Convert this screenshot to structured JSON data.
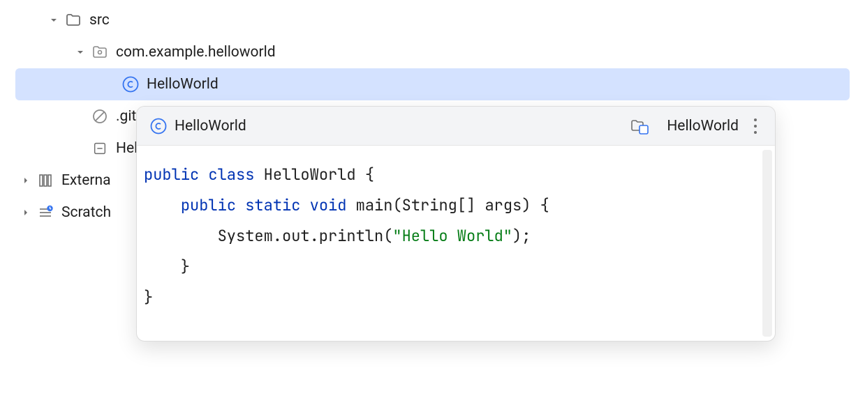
{
  "tree": {
    "src": {
      "label": "src"
    },
    "package": {
      "label": "com.example.helloworld"
    },
    "class_file": {
      "label": "HelloWorld"
    },
    "gitignore": {
      "label": ".gitig"
    },
    "hello_iml": {
      "label": "Hell"
    },
    "external": {
      "label": "Externa"
    },
    "scratches": {
      "label": "Scratch"
    }
  },
  "popup": {
    "title_left": "HelloWorld",
    "title_right": "HelloWorld",
    "code": {
      "l1_kw1": "public",
      "l1_kw2": "class",
      "l1_name": " HelloWorld {",
      "l2_kw1": "public",
      "l2_kw2": "static",
      "l2_kw3": "void",
      "l2_rest": " main(String[] args) {",
      "l3_pre": "        System.out.println(",
      "l3_str": "\"Hello World\"",
      "l3_post": ");",
      "l4": "    }",
      "l5": "}"
    }
  }
}
